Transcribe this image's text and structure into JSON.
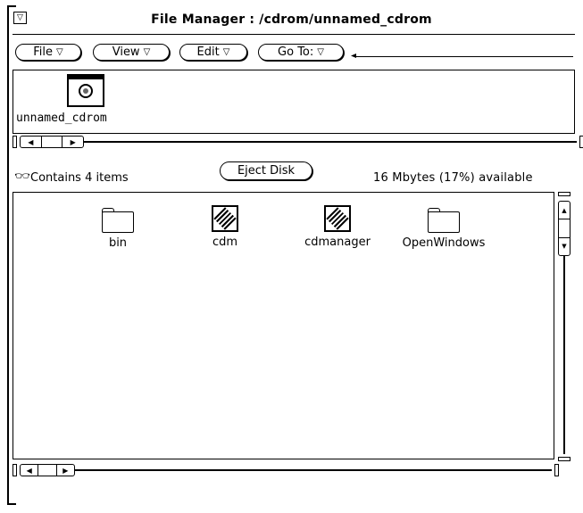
{
  "window": {
    "title": "File Manager : /cdrom/unnamed_cdrom",
    "menu_glyph": "▽"
  },
  "menubar": {
    "file_label": "File",
    "view_label": "View",
    "edit_label": "Edit",
    "goto_label": "Go To:",
    "arrow": "▽",
    "goto_value": ""
  },
  "volume": {
    "name": "unnamed_cdrom",
    "icon": "cdrom-icon"
  },
  "status": {
    "items_text": "Contains 4 items",
    "eject_label": "Eject Disk",
    "available_text": "16 Mbytes (17%) available",
    "icon": "binoculars-icon"
  },
  "files": [
    {
      "name": "bin",
      "icon": "folder-icon"
    },
    {
      "name": "cdm",
      "icon": "application-icon"
    },
    {
      "name": "cdmanager",
      "icon": "application-icon"
    },
    {
      "name": "OpenWindows",
      "icon": "folder-icon"
    }
  ],
  "scroll_glyphs": {
    "left": "◀",
    "right": "▶",
    "up": "▲",
    "down": "▼"
  }
}
